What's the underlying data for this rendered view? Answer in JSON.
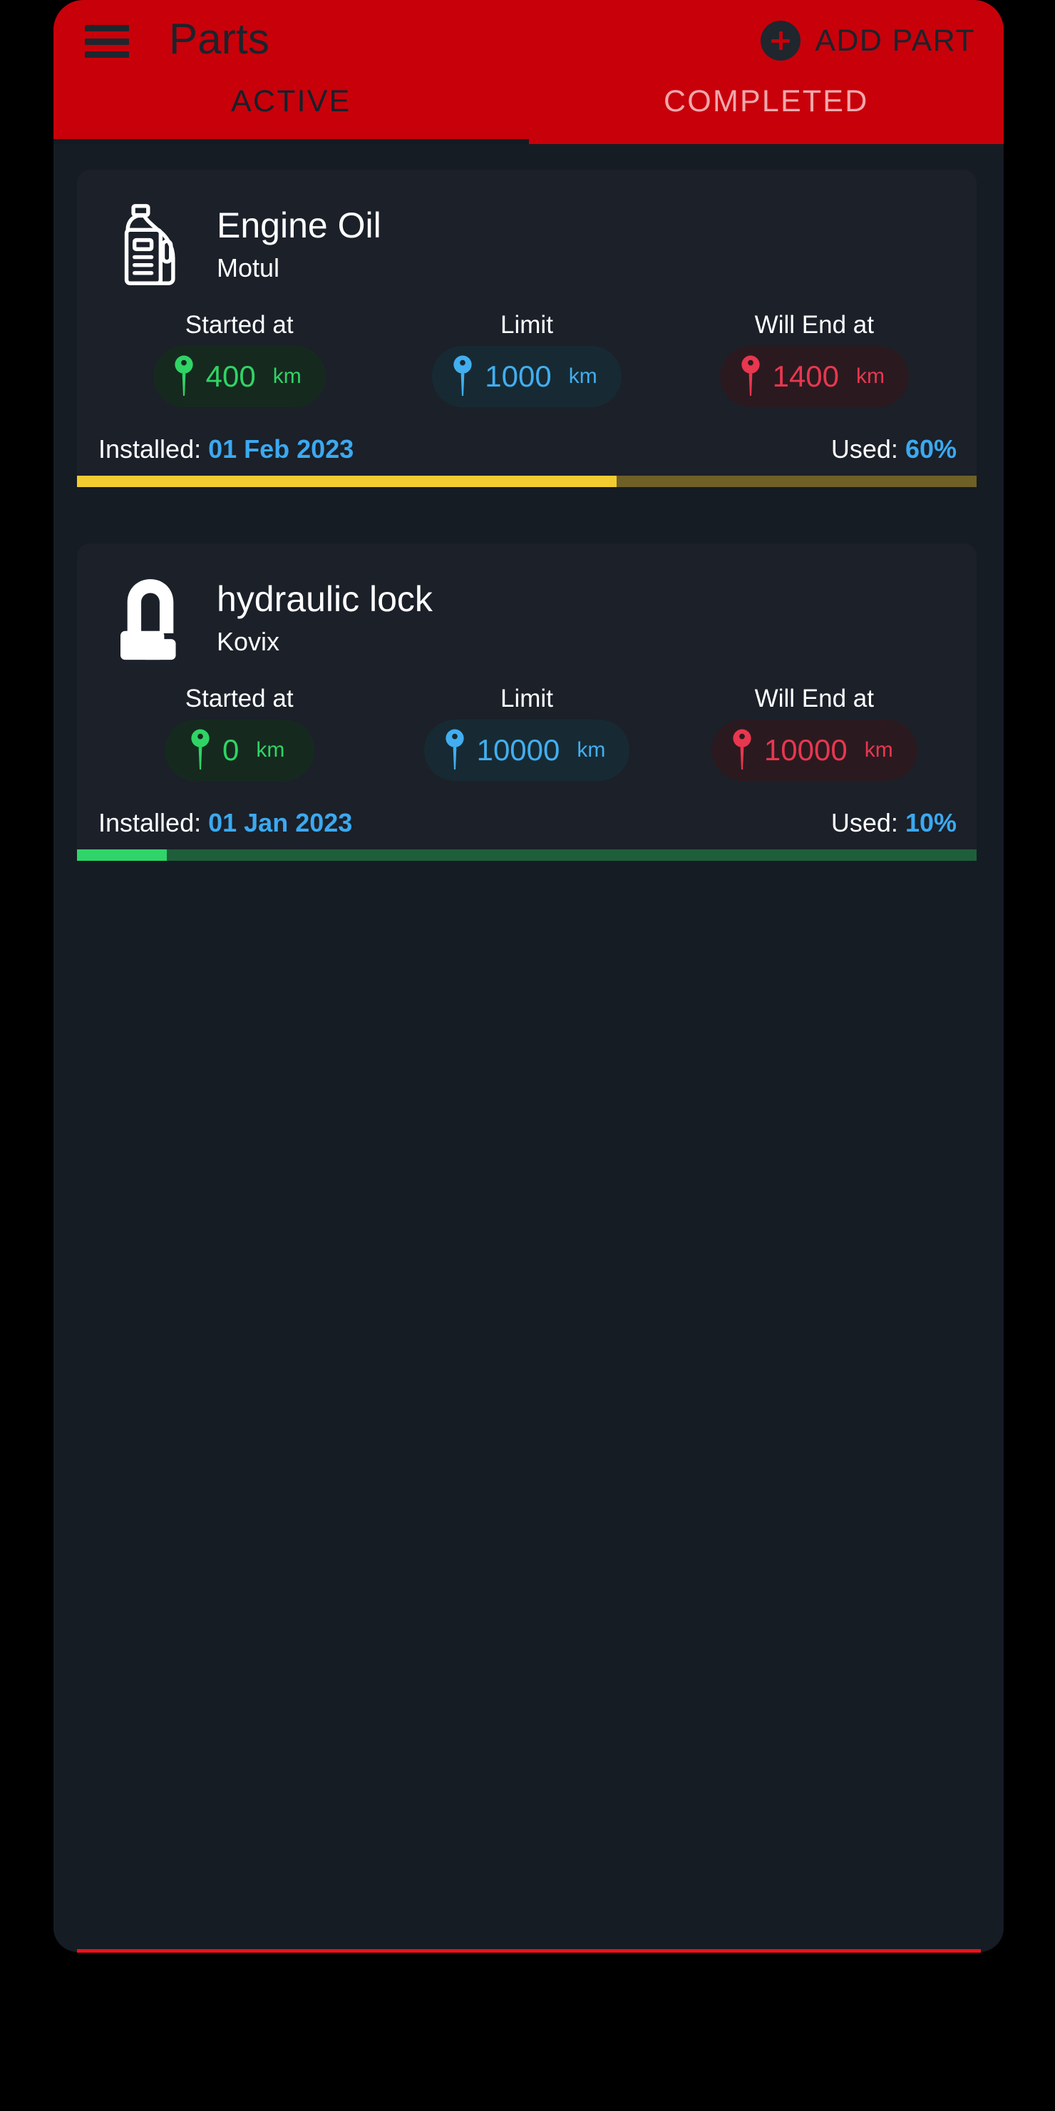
{
  "app": {
    "title": "Parts",
    "menu_icon": "hamburger-menu-icon",
    "add_button": {
      "label": "ADD PART",
      "icon": "plus-circle-icon"
    },
    "header_color": "#c8000a",
    "body_color": "#161c24",
    "card_color": "#1b2029"
  },
  "tabs": [
    {
      "label": "ACTIVE",
      "selected": true
    },
    {
      "label": "COMPLETED",
      "selected": false
    }
  ],
  "stat_labels": {
    "started": "Started at",
    "limit": "Limit",
    "will_end": "Will End at"
  },
  "footer_labels": {
    "installed": "Installed:",
    "used": "Used:"
  },
  "parts": [
    {
      "icon": "oil-bottle-icon",
      "title": "Engine Oil",
      "brand": "Motul",
      "started_at": {
        "value": "400",
        "unit": "km",
        "color": "#2fd465",
        "pin": "map-pin-icon"
      },
      "limit": {
        "value": "1000",
        "unit": "km",
        "color": "#42aef0",
        "pin": "map-pin-icon"
      },
      "will_end_at": {
        "value": "1400",
        "unit": "km",
        "color": "#e8374f",
        "pin": "map-pin-icon"
      },
      "installed_date": "01 Feb 2023",
      "used_percent": "60%",
      "progress": 60,
      "bar_fill_color": "#f2cb30",
      "bar_track_color": "#6e6026"
    },
    {
      "icon": "u-lock-icon",
      "title": "hydraulic lock",
      "brand": "Kovix",
      "started_at": {
        "value": "0",
        "unit": "km",
        "color": "#2fd465",
        "pin": "map-pin-icon"
      },
      "limit": {
        "value": "10000",
        "unit": "km",
        "color": "#42aef0",
        "pin": "map-pin-icon"
      },
      "will_end_at": {
        "value": "10000",
        "unit": "km",
        "color": "#e8374f",
        "pin": "map-pin-icon"
      },
      "installed_date": "01 Jan 2023",
      "used_percent": "10%",
      "progress": 10,
      "bar_fill_color": "#2fd46a",
      "bar_track_color": "#1f5e3b"
    }
  ]
}
